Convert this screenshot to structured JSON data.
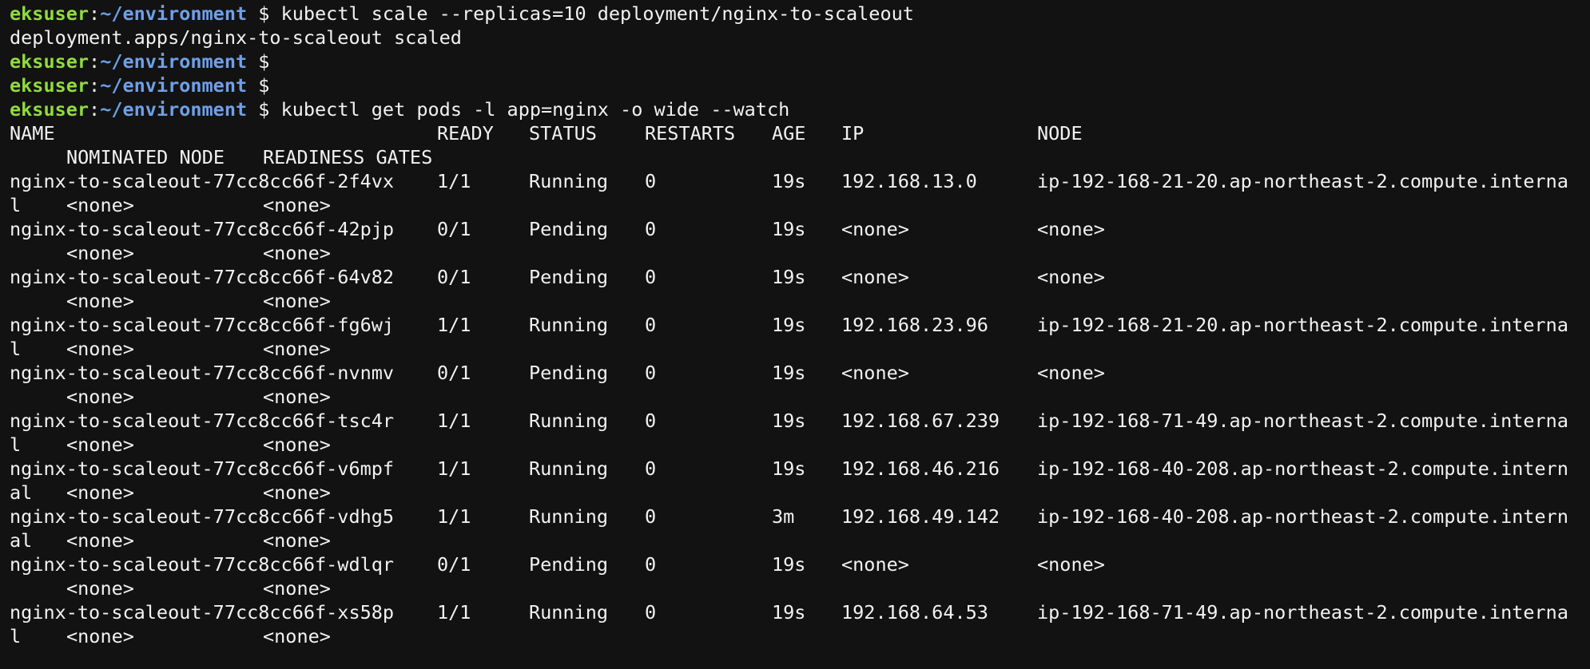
{
  "prompt": {
    "user": "eksuser",
    "colon": ":",
    "path": "~/environment",
    "symbol": " $ "
  },
  "commands": {
    "scale": "kubectl scale --replicas=10 deployment/nginx-to-scaleout",
    "scale_output": "deployment.apps/nginx-to-scaleout scaled",
    "get_pods": "kubectl get pods -l app=nginx -o wide --watch"
  },
  "table": {
    "headers": {
      "name": "NAME",
      "ready": "READY",
      "status": "STATUS",
      "restarts": "RESTARTS",
      "age": "AGE",
      "ip": "IP",
      "node": "NODE",
      "nominated_node": "NOMINATED NODE",
      "readiness_gates": "READINESS GATES"
    },
    "rows": [
      {
        "name": "nginx-to-scaleout-77cc8cc66f-2f4vx",
        "ready": "1/1",
        "status": "Running",
        "restarts": "0",
        "age": "19s",
        "ip": "192.168.13.0",
        "node": "ip-192-168-21-20.ap-northeast-2.compute.interna",
        "node_wrap": "l",
        "nominated": "<none>",
        "gates": "<none>"
      },
      {
        "name": "nginx-to-scaleout-77cc8cc66f-42pjp",
        "ready": "0/1",
        "status": "Pending",
        "restarts": "0",
        "age": "19s",
        "ip": "<none>",
        "node": "<none>",
        "node_wrap": "",
        "nominated": "<none>",
        "gates": "<none>"
      },
      {
        "name": "nginx-to-scaleout-77cc8cc66f-64v82",
        "ready": "0/1",
        "status": "Pending",
        "restarts": "0",
        "age": "19s",
        "ip": "<none>",
        "node": "<none>",
        "node_wrap": "",
        "nominated": "<none>",
        "gates": "<none>"
      },
      {
        "name": "nginx-to-scaleout-77cc8cc66f-fg6wj",
        "ready": "1/1",
        "status": "Running",
        "restarts": "0",
        "age": "19s",
        "ip": "192.168.23.96",
        "node": "ip-192-168-21-20.ap-northeast-2.compute.interna",
        "node_wrap": "l",
        "nominated": "<none>",
        "gates": "<none>"
      },
      {
        "name": "nginx-to-scaleout-77cc8cc66f-nvnmv",
        "ready": "0/1",
        "status": "Pending",
        "restarts": "0",
        "age": "19s",
        "ip": "<none>",
        "node": "<none>",
        "node_wrap": "",
        "nominated": "<none>",
        "gates": "<none>"
      },
      {
        "name": "nginx-to-scaleout-77cc8cc66f-tsc4r",
        "ready": "1/1",
        "status": "Running",
        "restarts": "0",
        "age": "19s",
        "ip": "192.168.67.239",
        "node": "ip-192-168-71-49.ap-northeast-2.compute.interna",
        "node_wrap": "l",
        "nominated": "<none>",
        "gates": "<none>"
      },
      {
        "name": "nginx-to-scaleout-77cc8cc66f-v6mpf",
        "ready": "1/1",
        "status": "Running",
        "restarts": "0",
        "age": "19s",
        "ip": "192.168.46.216",
        "node": "ip-192-168-40-208.ap-northeast-2.compute.intern",
        "node_wrap": "al",
        "nominated": "<none>",
        "gates": "<none>"
      },
      {
        "name": "nginx-to-scaleout-77cc8cc66f-vdhg5",
        "ready": "1/1",
        "status": "Running",
        "restarts": "0",
        "age": "3m",
        "ip": "192.168.49.142",
        "node": "ip-192-168-40-208.ap-northeast-2.compute.intern",
        "node_wrap": "al",
        "nominated": "<none>",
        "gates": "<none>"
      },
      {
        "name": "nginx-to-scaleout-77cc8cc66f-wdlqr",
        "ready": "0/1",
        "status": "Pending",
        "restarts": "0",
        "age": "19s",
        "ip": "<none>",
        "node": "<none>",
        "node_wrap": "",
        "nominated": "<none>",
        "gates": "<none>"
      },
      {
        "name": "nginx-to-scaleout-77cc8cc66f-xs58p",
        "ready": "1/1",
        "status": "Running",
        "restarts": "0",
        "age": "19s",
        "ip": "192.168.64.53",
        "node": "ip-192-168-71-49.ap-northeast-2.compute.interna",
        "node_wrap": "l",
        "nominated": "<none>",
        "gates": "<none>"
      }
    ]
  },
  "colors": {
    "background": "#121212",
    "text": "#f2f2f2",
    "prompt_user": "#8fdc3f",
    "prompt_path": "#6fa0e8"
  }
}
